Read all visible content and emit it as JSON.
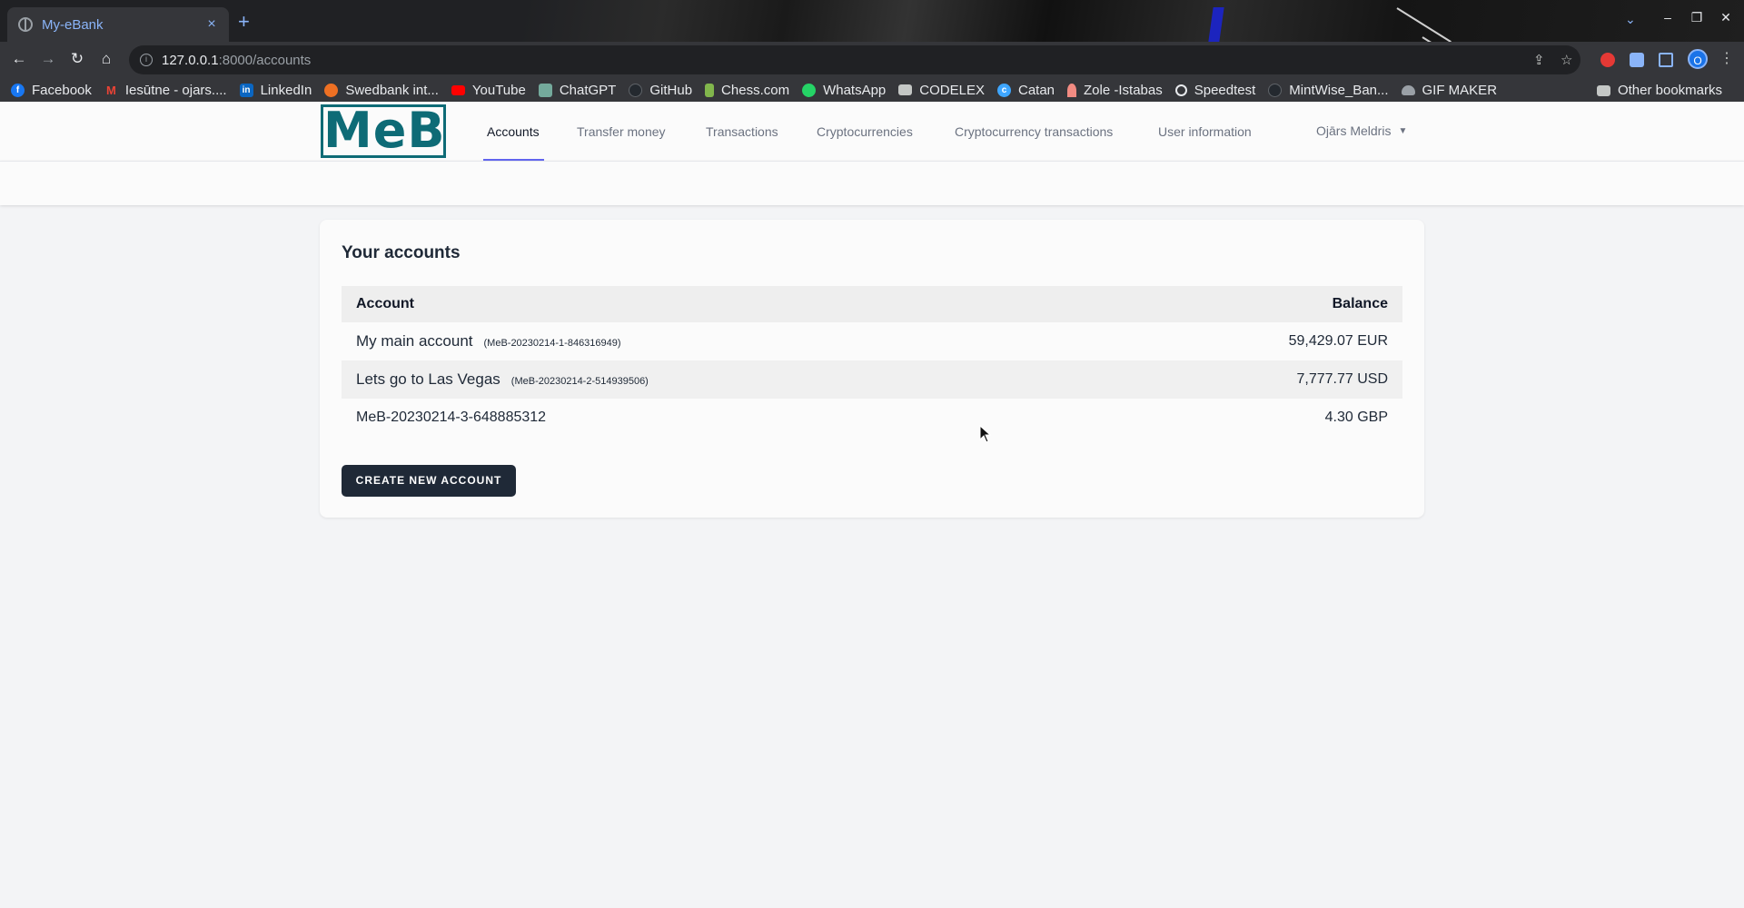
{
  "browser": {
    "tab_title": "My-eBank",
    "tab_close": "×",
    "new_tab": "+",
    "url_host": "127.0.0.1",
    "url_path": ":8000/accounts",
    "bookmarks": [
      {
        "label": "Facebook",
        "icon": "facebook-icon",
        "color": "#1877f2"
      },
      {
        "label": "Iesūtne - ojars....",
        "icon": "gmail-icon",
        "color": "#ea4335"
      },
      {
        "label": "LinkedIn",
        "icon": "linkedin-icon",
        "color": "#0a66c2"
      },
      {
        "label": "Swedbank int...",
        "icon": "swedbank-icon",
        "color": "#ee7023"
      },
      {
        "label": "YouTube",
        "icon": "youtube-icon",
        "color": "#ff0000"
      },
      {
        "label": "ChatGPT",
        "icon": "chatgpt-icon",
        "color": "#74aa9c"
      },
      {
        "label": "GitHub",
        "icon": "github-icon",
        "color": "#24292f"
      },
      {
        "label": "Chess.com",
        "icon": "chess-icon",
        "color": "#81b64c"
      },
      {
        "label": "WhatsApp",
        "icon": "whatsapp-icon",
        "color": "#25d366"
      },
      {
        "label": "CODELEX",
        "icon": "folder-icon",
        "color": "#c4c7c5"
      },
      {
        "label": "Catan",
        "icon": "catan-icon",
        "color": "#3ea6ff"
      },
      {
        "label": "Zole -Istabas",
        "icon": "zole-icon",
        "color": "#f28b82"
      },
      {
        "label": "Speedtest",
        "icon": "speedtest-icon",
        "color": "#141526"
      },
      {
        "label": "MintWise_Ban...",
        "icon": "github-icon",
        "color": "#24292f"
      },
      {
        "label": "GIF MAKER",
        "icon": "cloud-icon",
        "color": "#9aa0a6"
      }
    ],
    "other_bookmarks": "Other bookmarks"
  },
  "app": {
    "logo": "MeB",
    "nav": {
      "accounts": "Accounts",
      "transfer": "Transfer money",
      "transactions": "Transactions",
      "crypto": "Cryptocurrencies",
      "crypto_tx": "Cryptocurrency transactions",
      "user_info": "User information"
    },
    "user_name": "Ojārs Meldris",
    "accent_color": "#0e6b76"
  },
  "accounts_card": {
    "title": "Your accounts",
    "col_account": "Account",
    "col_balance": "Balance",
    "rows": [
      {
        "name": "My main account",
        "number": "(MeB-20230214-1-846316949)",
        "balance": "59,429.07 EUR"
      },
      {
        "name": "Lets go to Las Vegas",
        "number": "(MeB-20230214-2-514939506)",
        "balance": "7,777.77 USD"
      },
      {
        "name": "MeB-20230214-3-648885312",
        "number": "",
        "balance": "4.30 GBP"
      }
    ],
    "create_button": "CREATE NEW ACCOUNT"
  }
}
